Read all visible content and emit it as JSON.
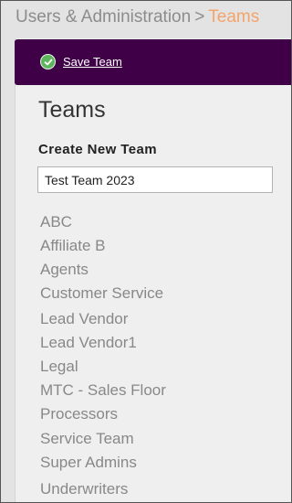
{
  "breadcrumb": {
    "parent": "Users & Administration",
    "separator": ">",
    "current": "Teams"
  },
  "toolbar": {
    "save_label": "Save Team",
    "save_icon": "check-circle-icon"
  },
  "page": {
    "title": "Teams",
    "create_label": "Create New Team",
    "create_value": "Test Team 2023"
  },
  "teams": [
    "ABC",
    "Affiliate B",
    "Agents",
    "Customer Service",
    "Lead Vendor",
    "Lead Vendor1",
    "Legal",
    "MTC - Sales Floor",
    "Processors",
    "Service Team",
    "Super Admins",
    "Underwriters"
  ],
  "colors": {
    "toolbar_bg": "#3f0048",
    "breadcrumb_current": "#f4a46b",
    "check_green": "#5fb55f"
  }
}
